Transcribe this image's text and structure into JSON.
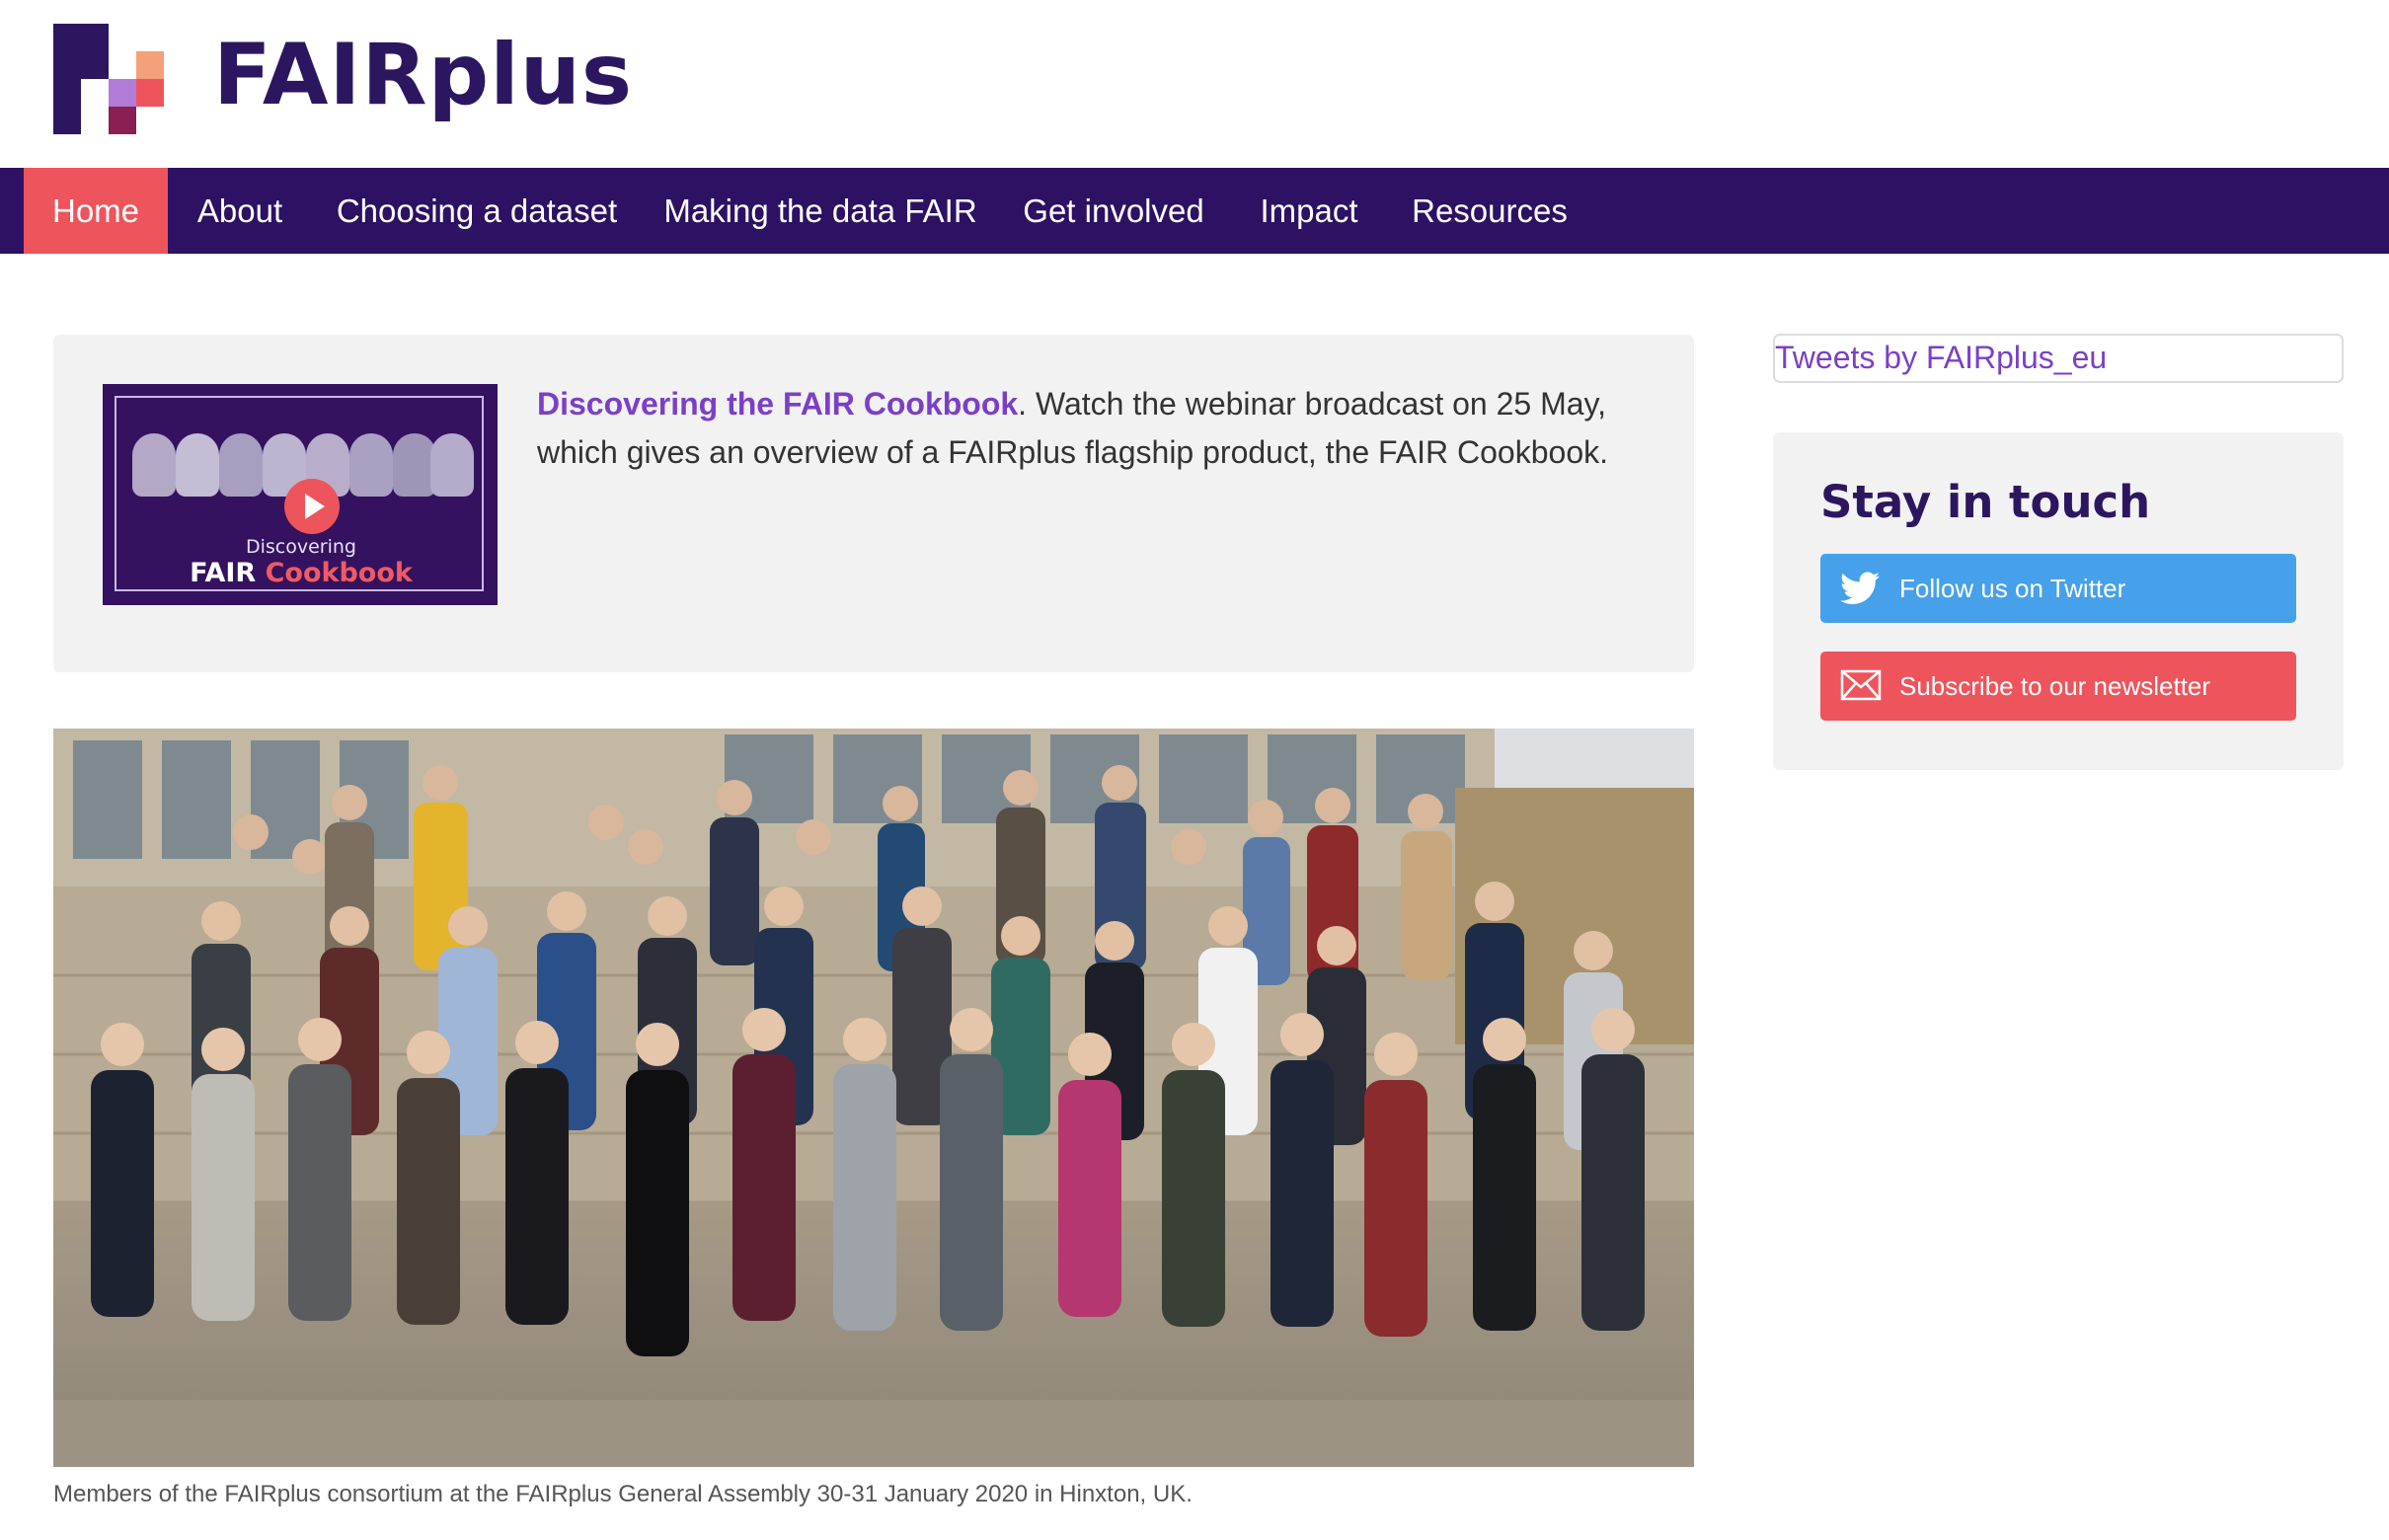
{
  "site": {
    "name": "FAIRplus"
  },
  "nav": {
    "items": [
      {
        "label": "Home"
      },
      {
        "label": "About"
      },
      {
        "label": "Choosing a dataset"
      },
      {
        "label": "Making the data FAIR"
      },
      {
        "label": "Get involved"
      },
      {
        "label": "Impact"
      },
      {
        "label": "Resources"
      }
    ]
  },
  "promo": {
    "thumbnail": {
      "top_text": "Discovering",
      "fair": "FAIR",
      "cookbook": "Cookbook"
    },
    "link_text": "Discovering the FAIR Cookbook",
    "text": ". Watch the webinar broadcast on 25 May, which gives an overview of a FAIRplus flagship product, the FAIR Cookbook."
  },
  "photo": {
    "caption": "Members of the FAIRplus consortium at the FAIRplus General Assembly 30-31 January 2020 in Hinxton, UK."
  },
  "sidebar": {
    "tweets_link": "Tweets by FAIRplus_eu",
    "stay_title": "Stay in touch",
    "twitter_button": "Follow us on Twitter",
    "newsletter_button": "Subscribe to our newsletter"
  },
  "colors": {
    "brand_dark": "#2d1163",
    "accent_red": "#ee545b",
    "link_purple": "#7b3fc7",
    "twitter_blue": "#46a0ea"
  }
}
